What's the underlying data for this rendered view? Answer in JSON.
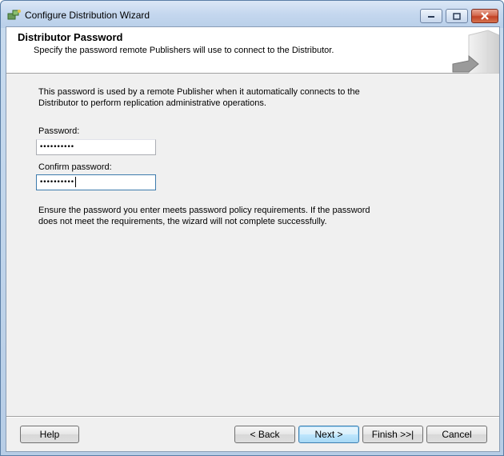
{
  "window": {
    "title": "Configure Distribution Wizard"
  },
  "header": {
    "title": "Distributor Password",
    "subtitle": "Specify the password remote Publishers will use to connect to the Distributor."
  },
  "main": {
    "description": "This password is used by a remote Publisher when it automatically connects to the Distributor to perform replication administrative operations.",
    "password_label": "Password:",
    "password_value": "••••••••••",
    "confirm_label": "Confirm password:",
    "confirm_value": "••••••••••",
    "note": "Ensure the password you enter meets password policy requirements. If the password does not meet the requirements, the wizard will not complete successfully."
  },
  "footer": {
    "help": "Help",
    "back": "< Back",
    "next": "Next >",
    "finish": "Finish >>|",
    "cancel": "Cancel"
  },
  "icons": {
    "title": "wizard-icon",
    "header_art": "server-arrow-icon"
  }
}
